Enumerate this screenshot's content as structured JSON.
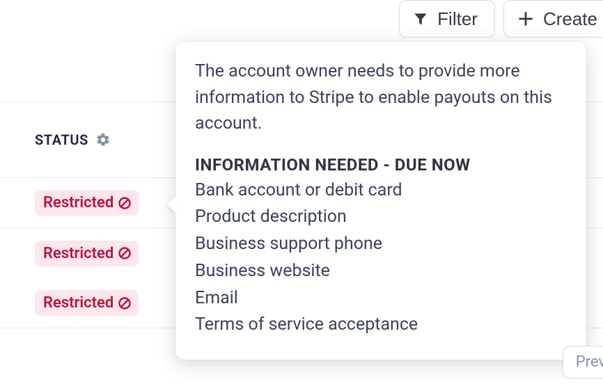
{
  "toolbar": {
    "filter_label": "Filter",
    "create_label": "Create"
  },
  "table": {
    "status_header": "STATUS",
    "rows": [
      {
        "badge_label": "Restricted"
      },
      {
        "badge_label": "Restricted"
      },
      {
        "badge_label": "Restricted"
      }
    ]
  },
  "tooltip": {
    "body": "The account owner needs to provide more information to Stripe to enable payouts on this account.",
    "heading": "INFORMATION NEEDED - DUE NOW",
    "items": [
      "Bank account or debit card",
      "Product description",
      "Business support phone",
      "Business website",
      "Email",
      "Terms of service acceptance"
    ]
  },
  "pager": {
    "prev_label": "Prev"
  },
  "icons": {
    "filter": "filter-icon",
    "plus": "plus-icon",
    "gear": "gear-icon",
    "block": "block-icon"
  },
  "colors": {
    "badge_bg": "#fde7ec",
    "badge_fg": "#bb133e",
    "border": "#e3e8ee"
  }
}
